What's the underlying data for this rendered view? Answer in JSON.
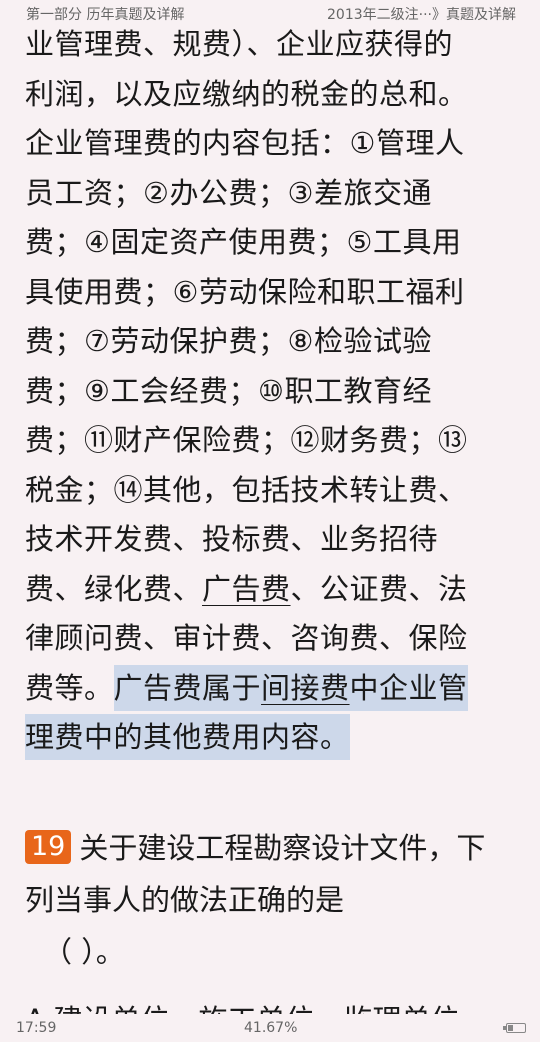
{
  "header": {
    "left": "第一部分  历年真题及详解",
    "right": "2013年二级注···》真题及详解"
  },
  "content": {
    "l1": "业管理费、规费）、企业应获得的",
    "l2": "利润，以及应缴纳的税金的总和。",
    "l3": "企业管理费的内容包括：①管理人",
    "l4": "员工资；②办公费；③差旅交通",
    "l5": "费；④固定资产使用费；⑤工具用",
    "l6": "具使用费；⑥劳动保险和职工福利",
    "l7": "费；⑦劳动保护费；⑧检验试验",
    "l8": "费；⑨工会经费；⑩职工教育经",
    "l9": "费；⑪财产保险费；⑫财务费；⑬",
    "l10": "税金；⑭其他，包括技术转让费、",
    "l11": "技术开发费、投标费、业务招待",
    "l12_a": "费、绿化费、",
    "l12_b": "广告费",
    "l12_c": "、公证费、法",
    "l13": "律顾问费、审计费、咨询费、保险",
    "l14_a": "费等。",
    "l14_b": "广告费属于",
    "l14_c": "间接费",
    "l14_d": "中企业管",
    "l15": "理费中的其他费用内容。"
  },
  "question": {
    "number": "19",
    "line1": "关于建设工程勘察设计文件，下",
    "line2": "列当事人的做法正确的是",
    "line3": "（      ）。",
    "cutoff": "A.建设单位、施工单位、监理单位"
  },
  "status_bar": {
    "time": "17:59",
    "progress": "41.67%",
    "battery_level": 0.3
  }
}
